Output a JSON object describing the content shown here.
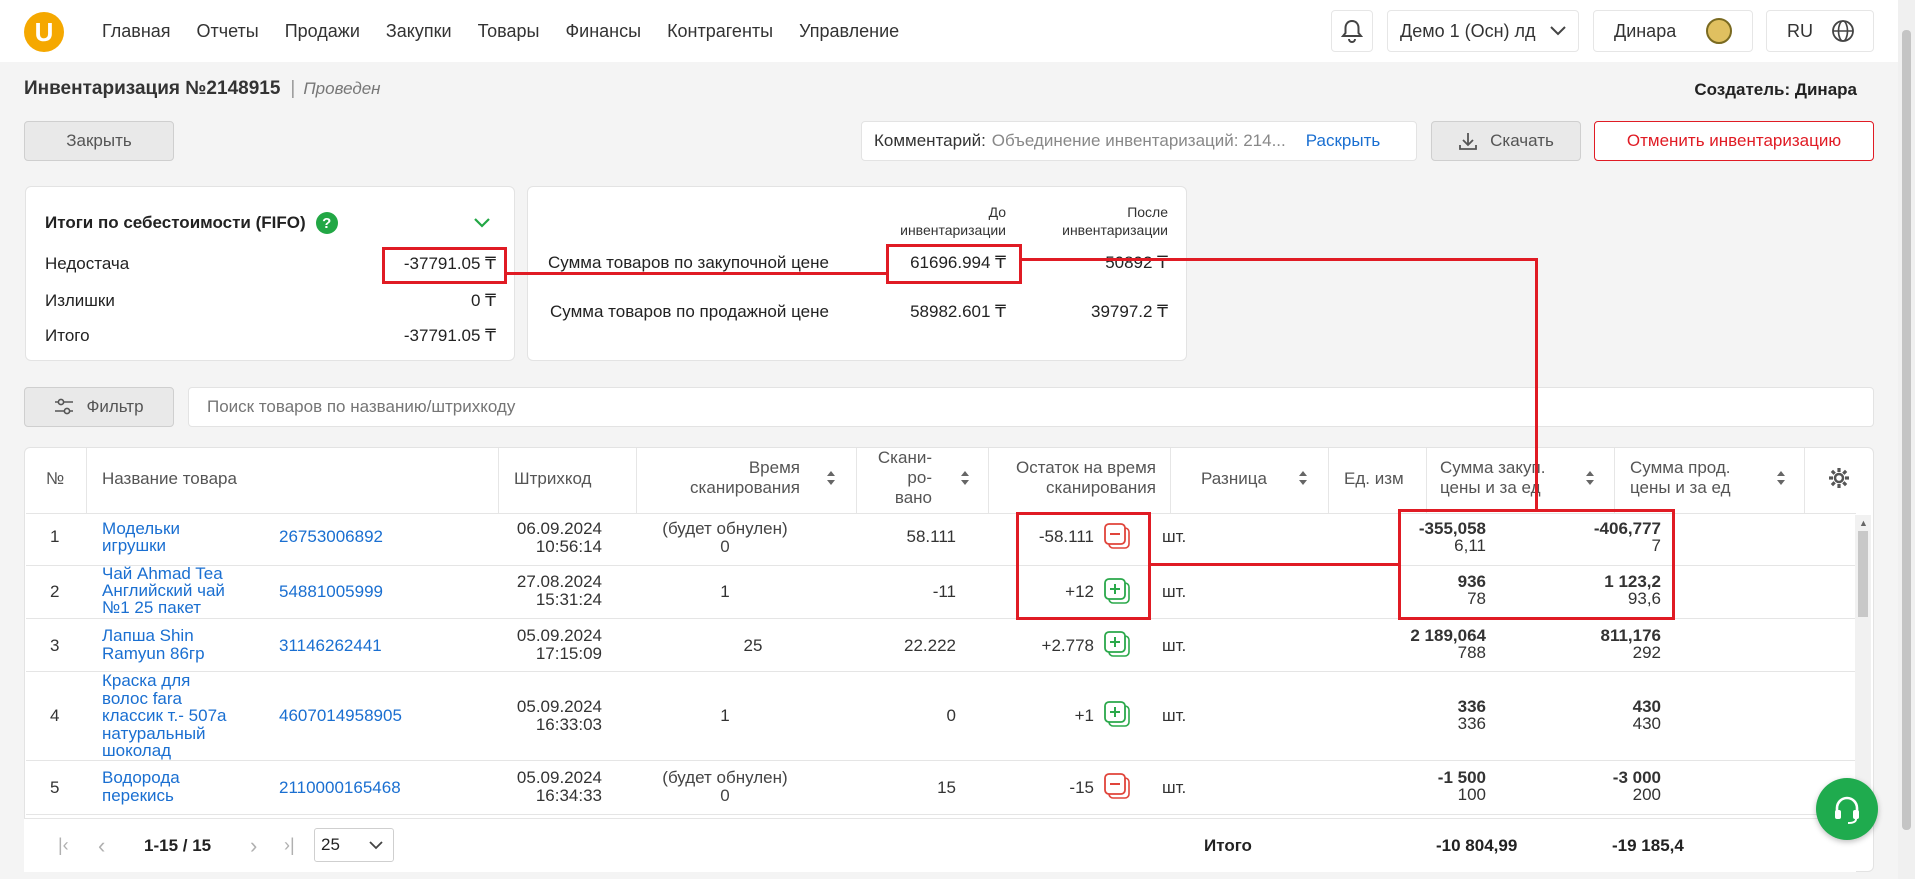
{
  "nav": {
    "logo": "U",
    "items": [
      "Главная",
      "Отчеты",
      "Продажи",
      "Закупки",
      "Товары",
      "Финансы",
      "Контрагенты",
      "Управление"
    ],
    "store": "Демо 1 (Осн) лд",
    "user": "Динара",
    "lang": "RU"
  },
  "header": {
    "title": "Инвентаризация №2148915",
    "separator": "|",
    "status": "Проведен",
    "creator": "Создатель: Динара"
  },
  "actions": {
    "close": "Закрыть",
    "comment_label": "Комментарий:",
    "comment_value": "Объединение инвентаризаций: 214...",
    "expand": "Раскрыть",
    "download": "Скачать",
    "cancel": "Отменить инвентаризацию"
  },
  "fifo": {
    "title": "Итоги по себестоимости (FIFO)",
    "rows": [
      {
        "label": "Недостача",
        "value": "-37791.05 ₸"
      },
      {
        "label": "Излишки",
        "value": "0 ₸"
      },
      {
        "label": "Итого",
        "value": "-37791.05 ₸"
      }
    ]
  },
  "totals": {
    "col_before_1": "До",
    "col_before_2": "инвентаризации",
    "col_after_1": "После",
    "col_after_2": "инвентаризации",
    "rows": [
      {
        "label": "Сумма товаров по закупочной цене",
        "before": "61696.994 ₸",
        "after": "50892 ₸"
      },
      {
        "label": "Сумма товаров по продажной цене",
        "before": "58982.601 ₸",
        "after": "39797.2 ₸"
      }
    ]
  },
  "filter": {
    "button": "Фильтр",
    "search_placeholder": "Поиск товаров по названию/штрихкоду"
  },
  "table": {
    "headers": {
      "num": "№",
      "name": "Название товара",
      "barcode": "Штрихкод",
      "scan_time_1": "Время",
      "scan_time_2": "сканирования",
      "scanned_1": "Скани-",
      "scanned_2": "ро-",
      "scanned_3": "вано",
      "stock_1": "Остаток на время",
      "stock_2": "сканирования",
      "diff": "Разница",
      "unit": "Ед. изм",
      "purchase_1": "Сумма закуп.",
      "purchase_2": "цены и за ед",
      "sale_1": "Сумма прод.",
      "sale_2": "цены и за ед"
    },
    "rows": [
      {
        "num": "1",
        "name_1": "Модельки",
        "name_2": "игрушки",
        "name_3": "",
        "name_4": "",
        "name_5": "",
        "barcode": "26753006892",
        "date": "06.09.2024",
        "time": "10:56:14",
        "scan_1": "(будет обнулен)",
        "scan_2": "0",
        "stock": "58.111",
        "diff": "-58.111",
        "diff_type": "minus",
        "unit": "шт.",
        "purchase_sum": "-355,058",
        "purchase_unit": "6,11",
        "sale_sum": "-406,777",
        "sale_unit": "7"
      },
      {
        "num": "2",
        "name_1": "Чай Ahmad Tea",
        "name_2": "Английский чай",
        "name_3": "№1 25 пакет",
        "name_4": "",
        "name_5": "",
        "barcode": "54881005999",
        "date": "27.08.2024",
        "time": "15:31:24",
        "scan_1": "",
        "scan_2": "1",
        "stock": "-11",
        "diff": "+12",
        "diff_type": "plus",
        "unit": "шт.",
        "purchase_sum": "936",
        "purchase_unit": "78",
        "sale_sum": "1 123,2",
        "sale_unit": "93,6"
      },
      {
        "num": "3",
        "name_1": "Лапша Shin",
        "name_2": "Ramyun 86гр",
        "name_3": "",
        "name_4": "",
        "name_5": "",
        "barcode": "31146262441",
        "date": "05.09.2024",
        "time": "17:15:09",
        "scan_1": "",
        "scan_2": "25",
        "stock": "22.222",
        "diff": "+2.778",
        "diff_type": "plus",
        "unit": "шт.",
        "purchase_sum": "2 189,064",
        "purchase_unit": "788",
        "sale_sum": "811,176",
        "sale_unit": "292"
      },
      {
        "num": "4",
        "name_1": "Краска для",
        "name_2": "волос fara",
        "name_3": "классик т.- 507а",
        "name_4": "натуральный",
        "name_5": "шоколад",
        "barcode": "4607014958905",
        "date": "05.09.2024",
        "time": "16:33:03",
        "scan_1": "",
        "scan_2": "1",
        "stock": "0",
        "diff": "+1",
        "diff_type": "plus",
        "unit": "шт.",
        "purchase_sum": "336",
        "purchase_unit": "336",
        "sale_sum": "430",
        "sale_unit": "430"
      },
      {
        "num": "5",
        "name_1": "Водорода",
        "name_2": "перекись",
        "name_3": "",
        "name_4": "",
        "name_5": "",
        "barcode": "2110000165468",
        "date": "05.09.2024",
        "time": "16:34:33",
        "scan_1": "(будет обнулен)",
        "scan_2": "0",
        "stock": "15",
        "diff": "-15",
        "diff_type": "minus",
        "unit": "шт.",
        "purchase_sum": "-1 500",
        "purchase_unit": "100",
        "sale_sum": "-3 000",
        "sale_unit": "200"
      }
    ],
    "footer": {
      "range": "1-15 / 15",
      "page_size": "25",
      "total_label": "Итого",
      "purchase_total": "-10 804,99",
      "sale_total": "-19 185,4"
    }
  },
  "colors": {
    "accent": "#f5a800",
    "link": "#1a6fd1",
    "danger": "#e01b24",
    "success": "#22a745",
    "support": "#1fab4e"
  }
}
